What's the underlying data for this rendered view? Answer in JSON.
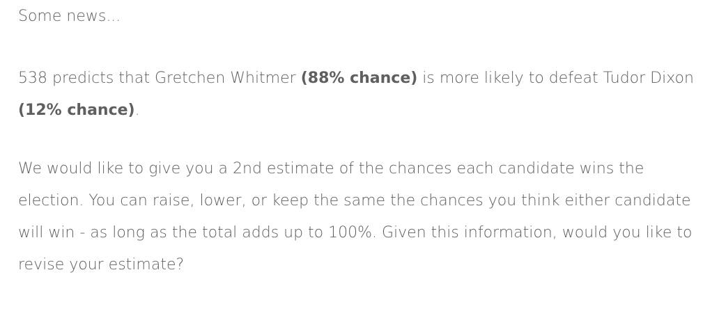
{
  "intro": "Some news...",
  "prediction": {
    "prefix": "538 predicts that Gretchen Whitmer ",
    "candidate_a_chance": "(88% chance)",
    "middle": " is more likely to defeat Tudor Dixon ",
    "candidate_b_chance": "(12% chance)",
    "suffix": "."
  },
  "question": "We would like to give you a 2nd estimate of the chances each candidate wins the election. You can raise, lower, or keep the same the chances you think either candidate will win - as long as the total adds up to 100%. Given this information, would you like to revise your estimate?"
}
